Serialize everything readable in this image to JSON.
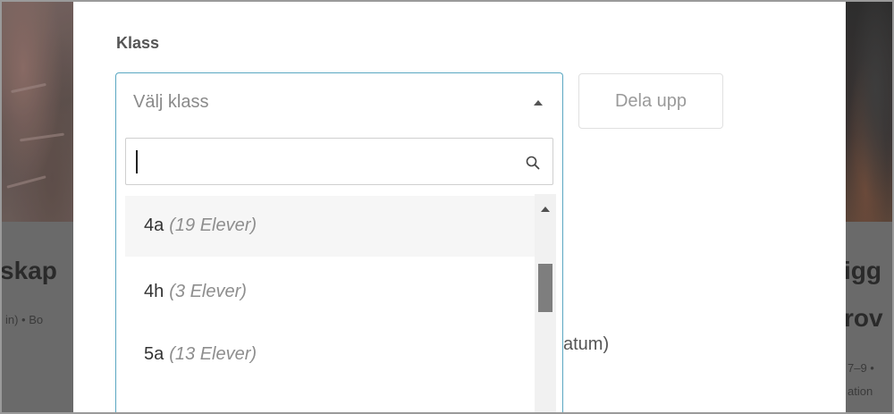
{
  "background": {
    "left_card_title": "skap",
    "left_card_sub": "in) • Bo",
    "right_card_title_line1": "igg",
    "right_card_title_line2": "rov",
    "right_card_sub_line1": "7–9 •",
    "right_card_sub_line2": "ation"
  },
  "modal": {
    "class_field": {
      "label": "Klass",
      "placeholder": "Välj klass",
      "caret_icon": "caret-up-icon"
    },
    "search": {
      "value": "",
      "icon": "search-icon"
    },
    "options": [
      {
        "name": "4a",
        "count": "(19 Elever)",
        "highlighted": true
      },
      {
        "name": "4h",
        "count": "(3 Elever)",
        "highlighted": false
      },
      {
        "name": "5a",
        "count": "(13 Elever)",
        "highlighted": false
      }
    ],
    "split_button_label": "Dela upp",
    "obscured_text": "atum)",
    "colors": {
      "focus_border": "#5aa7c2",
      "highlight_row": "#f6f6f6",
      "scroll_thumb": "#7e7e7e"
    }
  }
}
